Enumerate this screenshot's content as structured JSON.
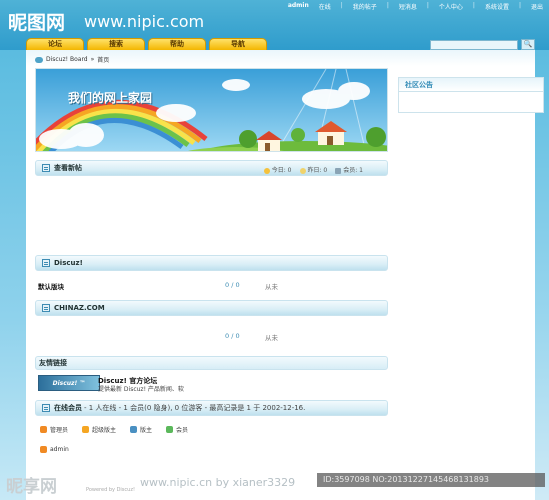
{
  "watermark": {
    "logo": "昵图网",
    "url": "www.nipic.com"
  },
  "topnav": {
    "user": "admin",
    "items": [
      "在线",
      "我的帖子",
      "短消息",
      "个人中心",
      "系统设置",
      "退出"
    ]
  },
  "navbar": {
    "tabs": [
      "论坛",
      "搜索",
      "帮助",
      "导航"
    ]
  },
  "search": {
    "placeholder": "",
    "button": "🔍"
  },
  "breadcrumb": {
    "home": "Discuz! Board",
    "sep": "»",
    "current": "首页"
  },
  "banner": {
    "title": "我们的网上家园"
  },
  "sidebar": {
    "title": "社区公告"
  },
  "sections": {
    "new_posts": {
      "title": "查看新帖",
      "today_label": "今日: 0",
      "yesterday_label": "昨日: 0",
      "members_label": "会员: 1"
    },
    "discuz": {
      "title": "Discuz!",
      "forum_name": "默认版块",
      "count": "0 / 0",
      "last": "从未"
    },
    "chinaz": {
      "title": "CHINAZ.COM",
      "count": "0 / 0",
      "last": "从未"
    },
    "friends": {
      "title": "友情链接",
      "logo_text": "Discuz! ™",
      "link_title": "Discuz! 官方论坛",
      "link_desc": "提供最新 Discuz! 产品新闻、软"
    },
    "online": {
      "title": "在线会员",
      "summary": "- 1 人在线 - 1 会员(0 隐身), 0 位游客 - 最高记录是 1 于 2002-12-16."
    }
  },
  "legend": {
    "items": [
      {
        "label": "管理员",
        "color": "#f08a24"
      },
      {
        "label": "超级版主",
        "color": "#f5a623"
      },
      {
        "label": "版主",
        "color": "#4a90c2"
      },
      {
        "label": "会员",
        "color": "#5bb85b"
      }
    ]
  },
  "online_user": "admin",
  "footer": {
    "logo": "昵享网",
    "url": "www.nipic.cn by xianer3329",
    "id": "ID:3597098 NO:20131227145468131893",
    "copy": "Powered by Discuz!"
  }
}
